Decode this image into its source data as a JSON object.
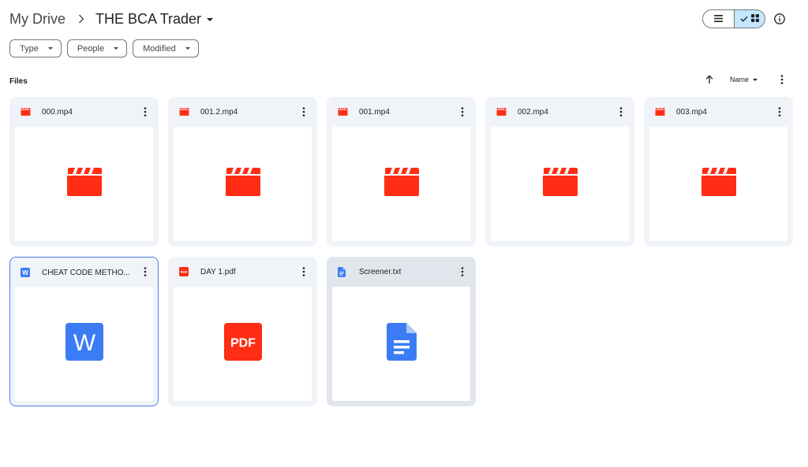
{
  "breadcrumb": {
    "root": "My Drive",
    "current": "THE BCA Trader"
  },
  "filters": [
    {
      "label": "Type"
    },
    {
      "label": "People"
    },
    {
      "label": "Modified"
    }
  ],
  "section": {
    "label": "Files"
  },
  "sort": {
    "label": "Name"
  },
  "view": {
    "active": "grid"
  },
  "files": [
    {
      "name": "000.mp4",
      "kind": "video"
    },
    {
      "name": "001.2.mp4",
      "kind": "video"
    },
    {
      "name": "001.mp4",
      "kind": "video"
    },
    {
      "name": "002.mp4",
      "kind": "video"
    },
    {
      "name": "003.mp4",
      "kind": "video"
    },
    {
      "name": "CHEAT CODE METHOD.docx",
      "display_name": "CHEAT CODE METHO...",
      "kind": "word",
      "selected": true
    },
    {
      "name": "DAY 1.pdf",
      "kind": "pdf"
    },
    {
      "name": "Screener.txt",
      "kind": "doc",
      "hover": true
    }
  ],
  "icon_text": {
    "word": "W",
    "pdf": "PDF",
    "pdf_small": "PDF",
    "word_small": "W"
  },
  "colors": {
    "video": "#ff2d13",
    "pdf": "#ff2d13",
    "word": "#3b7cf4",
    "doc": "#3b7cf4",
    "selected_border": "#4f7ee8",
    "toggle_active": "#c2e7ff"
  }
}
